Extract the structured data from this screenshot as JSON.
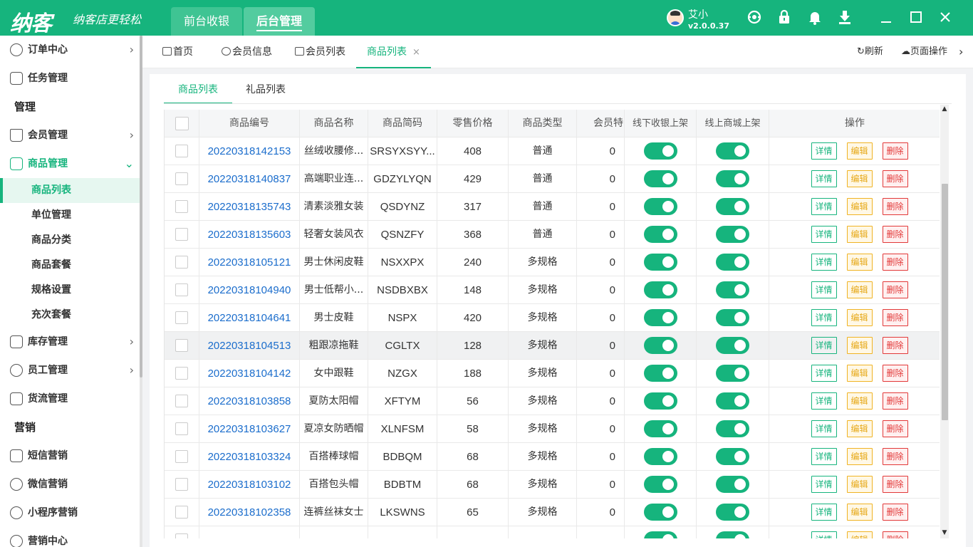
{
  "app": {
    "logo": "纳客",
    "slogan": "纳客店更轻松",
    "nav": [
      {
        "label": "前台收银"
      },
      {
        "label": "后台管理"
      }
    ],
    "user": {
      "name": "艾小",
      "version": "v2.0.0.37"
    },
    "icons": [
      "support-icon",
      "lock-icon",
      "bell-icon",
      "download-icon",
      "minimize-icon",
      "maximize-icon",
      "close-icon"
    ]
  },
  "sidebar": {
    "order_center": "订单中心",
    "task_management": "任务管理",
    "section_manage": "管理",
    "member_management": "会员管理",
    "product_management": "商品管理",
    "product_subitems": [
      "商品列表",
      "单位管理",
      "商品分类",
      "商品套餐",
      "规格设置",
      "充次套餐"
    ],
    "inventory_management": "库存管理",
    "staff_management": "员工管理",
    "logistics_management": "货流管理",
    "section_marketing": "营销",
    "sms_marketing": "短信营销",
    "wechat_marketing": "微信营销",
    "miniprogram_marketing": "小程序营销",
    "marketing_center": "营销中心"
  },
  "tabs": {
    "items": [
      "首页",
      "会员信息",
      "会员列表",
      "商品列表"
    ],
    "close": "×",
    "refresh": "刷新",
    "page_ops": "页面操作"
  },
  "subtabs": [
    "商品列表",
    "礼品列表"
  ],
  "table": {
    "columns": [
      "商品编号",
      "商品名称",
      "商品简码",
      "零售价格",
      "商品类型",
      "会员特",
      "线下收银上架",
      "线上商城上架",
      "操作"
    ],
    "actions": {
      "detail": "详情",
      "edit": "编辑",
      "delete": "删除"
    },
    "rows": [
      {
        "code": "20220318142153",
        "name": "丝绒收腰修...",
        "short": "SRSYXSYY...",
        "price": "408",
        "type": "普通",
        "member": "0"
      },
      {
        "code": "20220318140837",
        "name": "高端职业连...",
        "short": "GDZYLYQN",
        "price": "429",
        "type": "普通",
        "member": "0"
      },
      {
        "code": "20220318135743",
        "name": "清素淡雅女装",
        "short": "QSDYNZ",
        "price": "317",
        "type": "普通",
        "member": "0"
      },
      {
        "code": "20220318135603",
        "name": "轻奢女装风衣",
        "short": "QSNZFY",
        "price": "368",
        "type": "普通",
        "member": "0"
      },
      {
        "code": "20220318105121",
        "name": "男士休闲皮鞋",
        "short": "NSXXPX",
        "price": "240",
        "type": "多规格",
        "member": "0"
      },
      {
        "code": "20220318104940",
        "name": "男士低帮小...",
        "short": "NSDBXBX",
        "price": "148",
        "type": "多规格",
        "member": "0"
      },
      {
        "code": "20220318104641",
        "name": "男士皮鞋",
        "short": "NSPX",
        "price": "420",
        "type": "多规格",
        "member": "0"
      },
      {
        "code": "20220318104513",
        "name": "粗跟凉拖鞋",
        "short": "CGLTX",
        "price": "128",
        "type": "多规格",
        "member": "0"
      },
      {
        "code": "20220318104142",
        "name": "女中跟鞋",
        "short": "NZGX",
        "price": "188",
        "type": "多规格",
        "member": "0"
      },
      {
        "code": "20220318103858",
        "name": "夏防太阳帽",
        "short": "XFTYM",
        "price": "56",
        "type": "多规格",
        "member": "0"
      },
      {
        "code": "20220318103627",
        "name": "夏凉女防晒帽",
        "short": "XLNFSM",
        "price": "58",
        "type": "多规格",
        "member": "0"
      },
      {
        "code": "20220318103324",
        "name": "百搭棒球帽",
        "short": "BDBQM",
        "price": "68",
        "type": "多规格",
        "member": "0"
      },
      {
        "code": "20220318103102",
        "name": "百搭包头帽",
        "short": "BDBTM",
        "price": "68",
        "type": "多规格",
        "member": "0"
      },
      {
        "code": "20220318102358",
        "name": "连裤丝袜女士",
        "short": "LKSWNS",
        "price": "65",
        "type": "多规格",
        "member": "0"
      }
    ]
  },
  "colors": {
    "brand": "#16b47d",
    "link": "#1b6dcc",
    "edit": "#f0b323",
    "delete": "#e23838"
  }
}
